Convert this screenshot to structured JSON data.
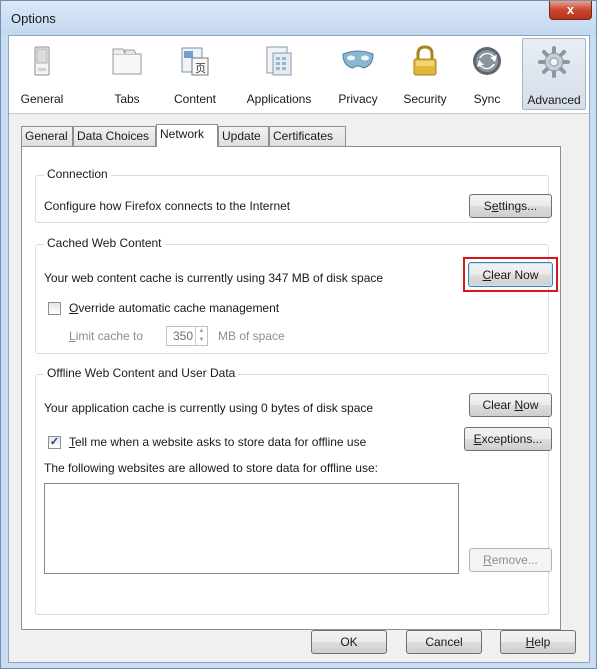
{
  "window": {
    "title": "Options",
    "close_label": "x"
  },
  "toolbar": {
    "items": [
      {
        "label": "General",
        "icon": "general-icon"
      },
      {
        "label": "Tabs",
        "icon": "tabs-icon"
      },
      {
        "label": "Content",
        "icon": "content-icon"
      },
      {
        "label": "Applications",
        "icon": "applications-icon"
      },
      {
        "label": "Privacy",
        "icon": "privacy-mask-icon"
      },
      {
        "label": "Security",
        "icon": "security-lock-icon"
      },
      {
        "label": "Sync",
        "icon": "sync-icon"
      },
      {
        "label": "Advanced",
        "icon": "advanced-gear-icon"
      }
    ],
    "active": "Advanced"
  },
  "tabs": {
    "items": [
      {
        "label": "General"
      },
      {
        "label": "Data Choices"
      },
      {
        "label": "Network"
      },
      {
        "label": "Update"
      },
      {
        "label": "Certificates"
      }
    ],
    "active": "Network"
  },
  "connection": {
    "title": "Connection",
    "description": "Configure how Firefox connects to the Internet",
    "settings_button": {
      "pre": "S",
      "ul": "e",
      "post": "ttings..."
    }
  },
  "cache": {
    "title": "Cached Web Content",
    "description": "Your web content cache is currently using 347 MB of disk space",
    "clear_button": {
      "pre": "",
      "ul": "C",
      "post": "lear Now"
    },
    "override_checkbox": {
      "checked": false,
      "pre": "",
      "ul": "O",
      "post": "verride automatic cache management"
    },
    "limit_label": {
      "pre": "",
      "ul": "L",
      "post": "imit cache to"
    },
    "limit_value": "350",
    "limit_unit": "MB of space"
  },
  "offline": {
    "title": "Offline Web Content and User Data",
    "description": "Your application cache is currently using 0 bytes of disk space",
    "clear_button": {
      "pre": "Clear ",
      "ul": "N",
      "post": "ow"
    },
    "notify_checkbox": {
      "checked": true,
      "pre": "",
      "ul": "T",
      "post": "ell me when a website asks to store data for offline use"
    },
    "exceptions_button": {
      "pre": "",
      "ul": "E",
      "post": "xceptions..."
    },
    "allowed_label": "The following websites are allowed to store data for offline use:",
    "allowed_sites": [],
    "remove_button": {
      "pre": "",
      "ul": "R",
      "post": "emove..."
    }
  },
  "footer": {
    "ok_label": "OK",
    "cancel_label": "Cancel",
    "help_button": {
      "pre": "",
      "ul": "H",
      "post": "elp"
    }
  },
  "colors": {
    "highlight": "#d9141b",
    "title_bar": "#c9dcf1",
    "close_button": "#c9462c"
  }
}
